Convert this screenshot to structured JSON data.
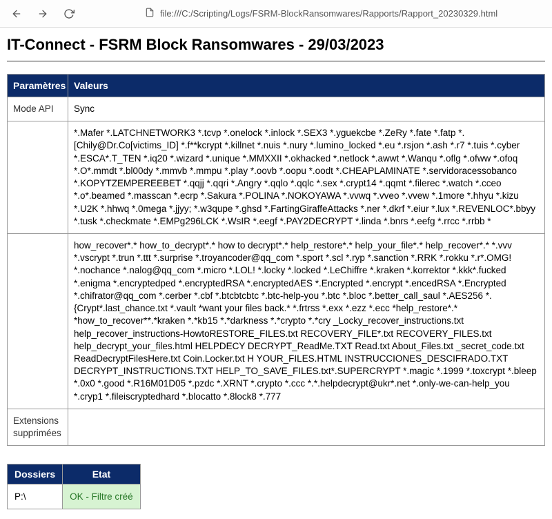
{
  "browser": {
    "url": "file:///C:/Scripting/Logs/FSRM-BlockRansomwares/Rapports/Rapport_20230329.html"
  },
  "page": {
    "title": "IT-Connect - FSRM Block Ransomwares - 29/03/2023"
  },
  "paramsTable": {
    "headers": {
      "col1": "Paramètres",
      "col2": "Valeurs"
    },
    "rows": [
      {
        "label": "Mode API",
        "value": "Sync"
      },
      {
        "label": "",
        "value": "*.Mafer *.LATCHNETWORK3 *.tcvp *.onelock *.inlock *.SEX3 *.yguekcbe *.ZeRy *.fate *.fatp *.[Chily@Dr.Co[victims_ID] *.f**kcrypt *.killnet *.nuis *.nury *.lumino_locked *.eu *.rsjon *.ash *.r7 *.tuis *.cyber *.ESCA*.T_TEN *.iq20 *.wizard *.unique *.MMXXII *.okhacked *.netlock *.awwt *.Wanqu *.oflg *.ofww *.ofoq *.O*.mmdt *.bl00dy *.mmvb *.mmpu *.play *.oovb *.oopu *.oodt *.CHEAPLAMINATE *.servidoracessobanco *.KOPYTZEMPEREEBET *.qqjj *.qqri *.Angry *.qqlo *.qqlc *.sex *.crypt14 *.qqmt *.filerec *.watch *.cceo *.o*.beamed *.masscan *.ecrp *.Sakura *.POLINA *.NOKOYAWA *.vvwq *.vveo *.vvew *.1more *.hhyu *.kizu *.U2K *.hhwq *.0mega *.jjyy; *.w3qupe *.ghsd *.FartingGiraffeAttacks *.ner *.dkrf *.eiur *.lux *.REVENLOC*.bbyy *.tusk *.checkmate *.EMPg296LCK *.WsIR *.eegf *.PAY2DECRYPT *.linda *.bnrs *.eefg *.rrcc *.rrbb *"
      },
      {
        "label": "",
        "value": "how_recover*.* how_to_decrypt*.* how to decrypt*.* help_restore*.* help_your_file*.* help_recover*.* *.vvv *.vscrypt *.trun *.ttt *.surprise *.troyancoder@qq_com *.sport *.scl *.ryp *.sanction *.RRK *.rokku *.r*.OMG! *.nochance *.nalog@qq_com *.micro *.LOL! *.locky *.locked *.LeChiffre *.kraken *.korrektor *.kkk*.fucked *.enigma *.encryptedped *.encryptedRSA *.encryptedAES *.Encrypted *.encrypt *.encedRSA *.Encrypted *.chifrator@qq_com *.cerber *.cbf *.btcbtcbtc *.btc-help-you *.btc *.bloc *.better_call_saul *.AES256 *.{Crypt*.last_chance.txt *.vault *want your files back.* *.frtrss *.exx *.ezz *.ecc *help_restore*.* *how_to_recover**.*kraken *.*kb15 *.*darkness *.*crypto *.*cry _Locky_recover_instructions.txt help_recover_instructions-HowtoRESTORE_FILES.txt RECOVERY_FILE*.txt RECOVERY_FILES.txt help_decrypt_your_files.html HELPDECY DECRYPT_ReadMe.TXT Read.txt About_Files.txt _secret_code.txt ReadDecryptFilesHere.txt Coin.Locker.txt H YOUR_FILES.HTML INSTRUCCIONES_DESCIFRADO.TXT DECRYPT_INSTRUCTIONS.TXT HELP_TO_SAVE_FILES.txt*.SUPERCRYPT *.magic *.1999 *.toxcrypt *.bleep *.0x0 *.good *.R16M01D05 *.pzdc *.XRNT *.crypto *.ccc *.*.helpdecrypt@ukr*.net *.only-we-can-help_you *.cryp1 *.fileiscryptedhard *.blocatto *.8lock8 *.777"
      },
      {
        "label": "Extensions supprimées",
        "value": ""
      }
    ]
  },
  "foldersTable": {
    "headers": {
      "col1": "Dossiers",
      "col2": "Etat"
    },
    "rows": [
      {
        "folder": "P:\\",
        "status": "OK - Filtre créé"
      }
    ]
  }
}
